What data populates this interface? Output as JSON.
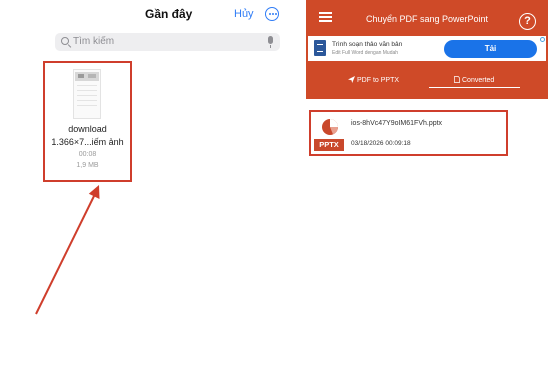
{
  "left_panel": {
    "title": "Gần đây",
    "cancel_label": "Hủy",
    "more_icon": "ellipsis-circle-icon",
    "search": {
      "placeholder": "Tìm kiếm",
      "icon": "search-icon",
      "mic_icon": "microphone-icon"
    },
    "file": {
      "name_line1": "download",
      "name_line2": "1.366×7...iếm ảnh",
      "time": "00:08",
      "size": "1,9 MB"
    }
  },
  "right_panel": {
    "title": "Chuyển PDF sang PowerPoint",
    "menu_icon": "hamburger-menu-icon",
    "help_icon": "help-circle-icon",
    "help_glyph": "?",
    "ad": {
      "title": "Trình soạn thảo văn bản",
      "subtitle": "Edit Full Word dengan Mudah",
      "button_label": "Tải"
    },
    "tabs": [
      {
        "label": "PDF to PPTX",
        "icon": "send-icon",
        "active": false
      },
      {
        "label": "Converted",
        "icon": "document-icon",
        "active": true
      }
    ],
    "files": [
      {
        "icon_label": "PPTX",
        "name": "ios-8hVc47Y9oIM61FVh.pptx",
        "date": "03/18/2026 00:09:18"
      }
    ]
  },
  "colors": {
    "highlight_box": "#cf3e2c",
    "app_accent": "#cf4a28",
    "ios_blue": "#2f7cf6",
    "ad_button": "#1a73e8"
  }
}
